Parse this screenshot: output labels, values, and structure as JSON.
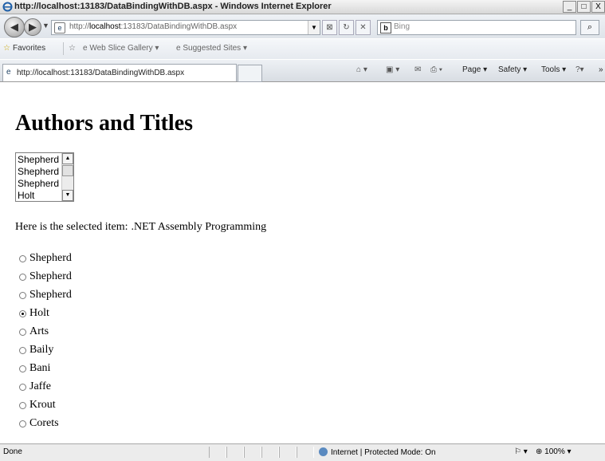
{
  "window": {
    "title": "http://localhost:13183/DataBindingWithDB.aspx - Windows Internet Explorer",
    "minimize": "_",
    "maximize": "□",
    "close": "X"
  },
  "address_bar": {
    "url_prefix": "http://",
    "url_host": "localhost",
    "url_rest": ":13183/DataBindingWithDB.aspx",
    "search_placeholder": "Bing"
  },
  "favorites_bar": {
    "favorites_label": "Favorites",
    "web_slice_label": "Web Slice Gallery ▾",
    "suggested_label": "Suggested Sites ▾"
  },
  "tab": {
    "label": "http://localhost:13183/DataBindingWithDB.aspx"
  },
  "command_bar": {
    "page": "Page ▾",
    "safety": "Safety ▾",
    "tools": "Tools ▾",
    "more": "»"
  },
  "page": {
    "heading": "Authors and Titles",
    "listbox_items": [
      "Shepherd",
      "Shepherd",
      "Shepherd",
      "Holt"
    ],
    "selected_label": "Here is the selected item:",
    "selected_value": ".NET Assembly Programming",
    "radio_items": [
      {
        "label": "Shepherd",
        "checked": false
      },
      {
        "label": "Shepherd",
        "checked": false
      },
      {
        "label": "Shepherd",
        "checked": false
      },
      {
        "label": "Holt",
        "checked": true
      },
      {
        "label": "Arts",
        "checked": false
      },
      {
        "label": "Baily",
        "checked": false
      },
      {
        "label": "Bani",
        "checked": false
      },
      {
        "label": "Jaffe",
        "checked": false
      },
      {
        "label": "Krout",
        "checked": false
      },
      {
        "label": "Corets",
        "checked": false
      }
    ]
  },
  "status_bar": {
    "status": "Done",
    "zone": "Internet | Protected Mode: On",
    "zoom": "100%"
  }
}
